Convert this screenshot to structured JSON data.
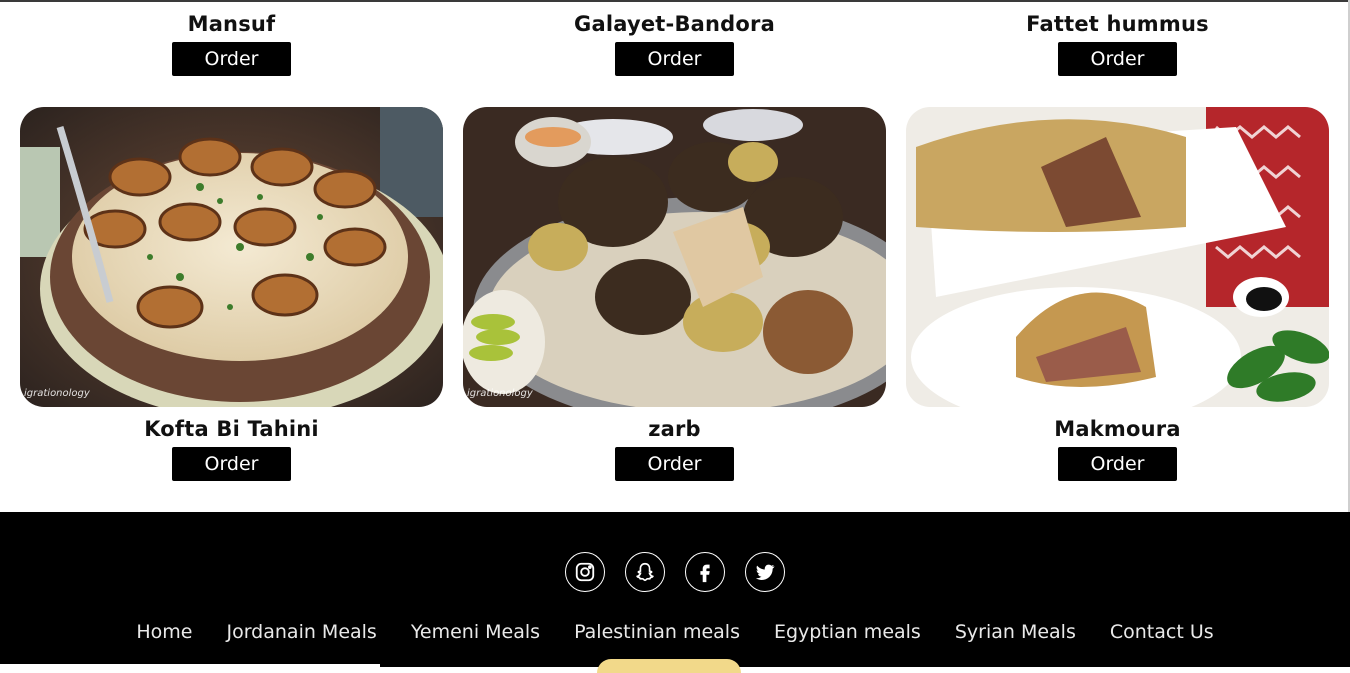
{
  "order_label": "Order",
  "row1": [
    {
      "name": "Mansuf"
    },
    {
      "name": "Galayet-Bandora"
    },
    {
      "name": "Fattet hummus"
    }
  ],
  "row2": [
    {
      "name": "Kofta Bi Tahini",
      "image": "kofta-bi-tahini-photo",
      "watermark": "igrationology"
    },
    {
      "name": "zarb",
      "image": "zarb-photo",
      "watermark": "igrationology"
    },
    {
      "name": "Makmoura",
      "image": "makmoura-photo",
      "watermark": ""
    }
  ],
  "footer": {
    "social_icons": [
      "instagram-icon",
      "snapchat-icon",
      "facebook-icon",
      "twitter-icon"
    ],
    "nav": [
      "Home",
      "Jordanain Meals",
      "Yemeni Meals",
      "Palestinian meals",
      "Egyptian meals",
      "Syrian Meals",
      "Contact Us"
    ],
    "accent_color": "#f2d98a"
  }
}
